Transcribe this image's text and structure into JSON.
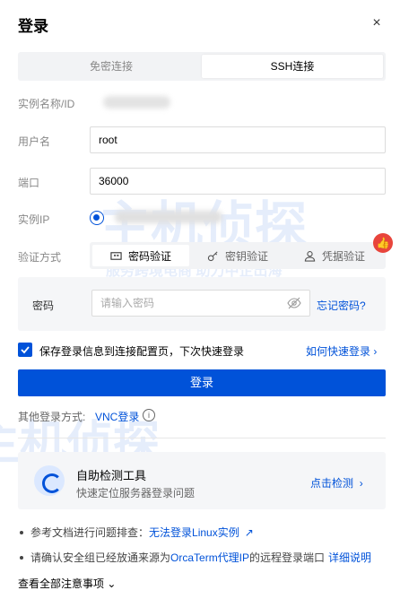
{
  "dialog": {
    "title": "登录",
    "close": "×"
  },
  "tabs": [
    {
      "label": "免密连接",
      "active": false
    },
    {
      "label": "SSH连接",
      "active": true
    }
  ],
  "fields": {
    "instance_label": "实例名称/ID",
    "user_label": "用户名",
    "user_value": "root",
    "port_label": "端口",
    "port_value": "36000",
    "ip_label": "实例IP",
    "auth_label": "验证方式"
  },
  "auth_methods": [
    {
      "label": "密码验证",
      "icon": "password-icon",
      "active": true
    },
    {
      "label": "密钥验证",
      "icon": "key-icon",
      "active": false
    },
    {
      "label": "凭据验证",
      "icon": "user-icon",
      "active": false
    }
  ],
  "password": {
    "label": "密码",
    "placeholder": "请输入密码",
    "forgot": "忘记密码?"
  },
  "save": {
    "label": "保存登录信息到连接配置页，下次快速登录",
    "checked": true,
    "howto": "如何快速登录"
  },
  "login_button": "登录",
  "other_login": {
    "label": "其他登录方式:",
    "vnc": "VNC登录",
    "info": "i"
  },
  "tool": {
    "title": "自助检测工具",
    "desc": "快速定位服务器登录问题",
    "link": "点击检测"
  },
  "notes": [
    {
      "text": "参考文档进行问题排查：",
      "link": "无法登录Linux实例",
      "suffix": ""
    },
    {
      "text": "请确认安全组已经放通来源为",
      "link": "OrcaTerm代理IP",
      "suffix": "的远程登录端口",
      "link2": "详细说明"
    }
  ],
  "view_all": "查看全部注意事项",
  "watermark": {
    "brand": "主机侦探",
    "slogan": "服务跨境电商 助力中企出海",
    "slogan_short": "助力中企出海"
  },
  "colors": {
    "accent": "#0052d9",
    "bg_panel": "#f5f6f8"
  }
}
